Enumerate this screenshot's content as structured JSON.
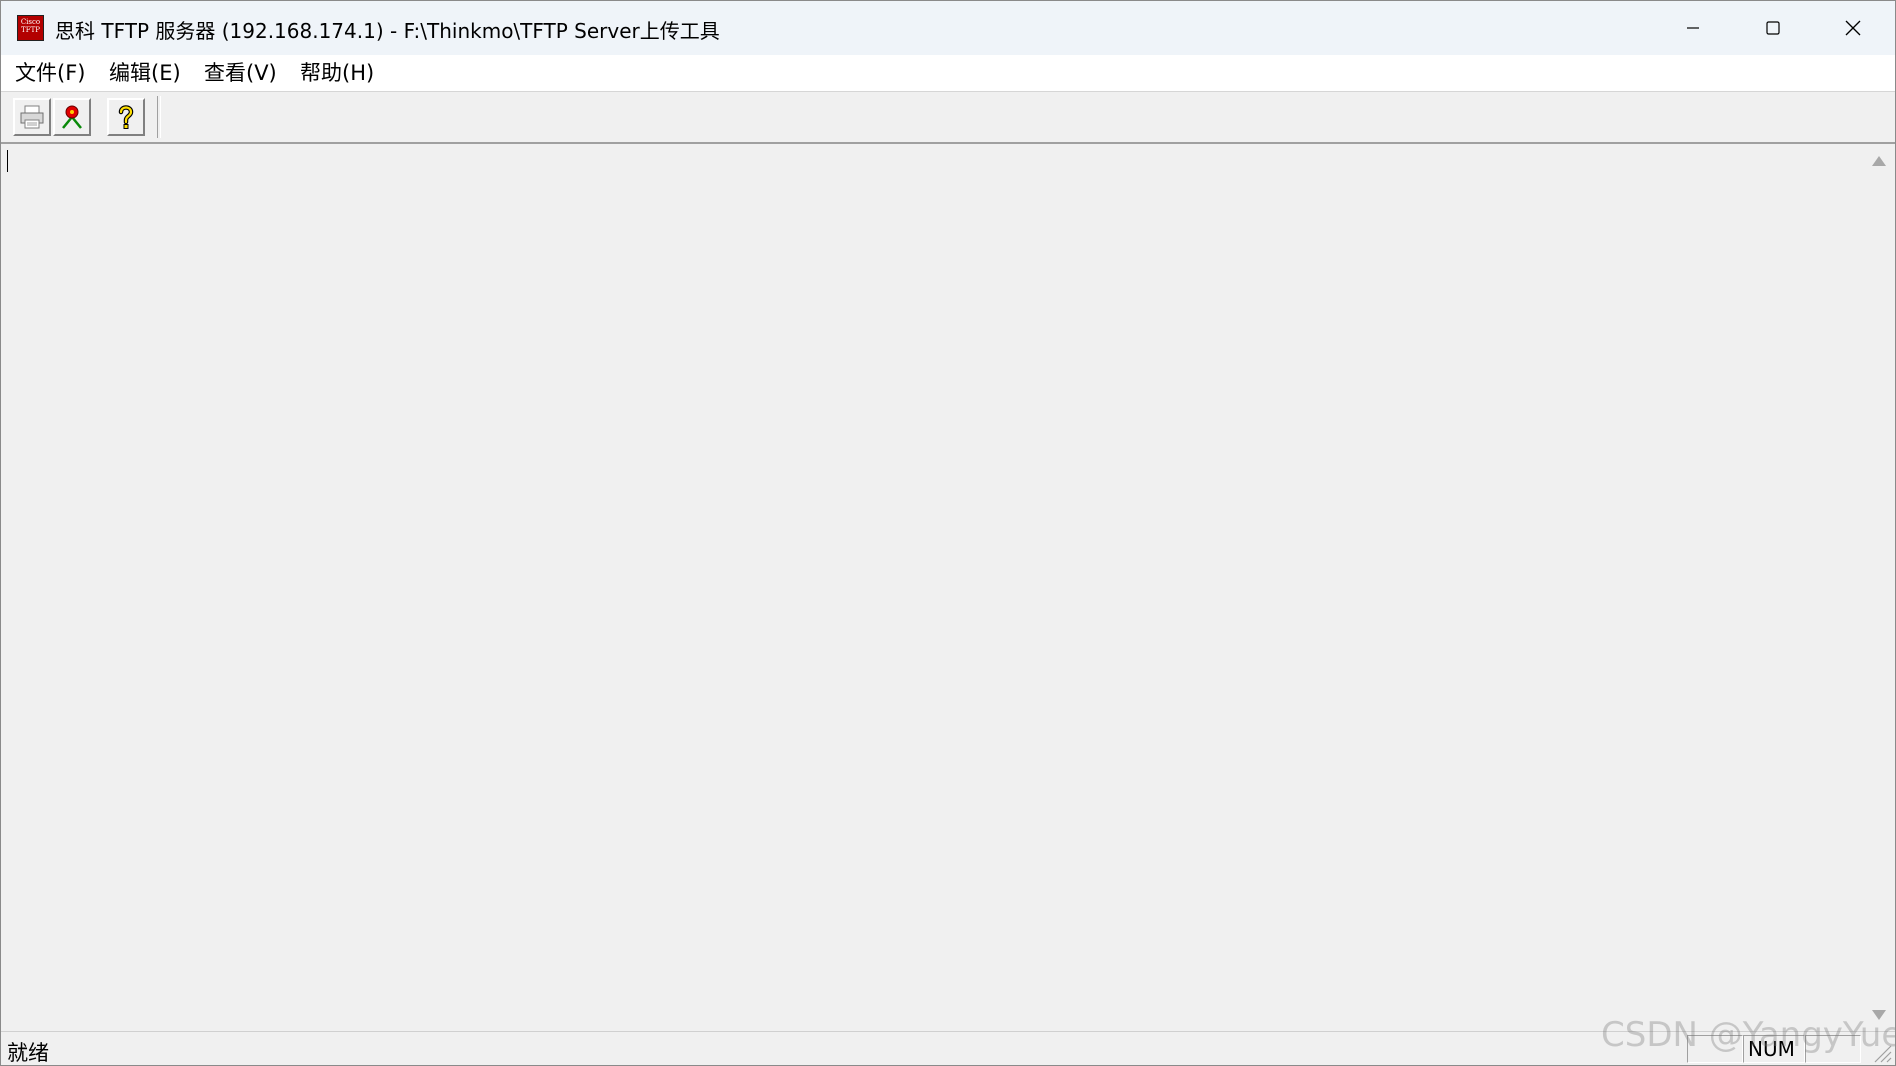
{
  "window": {
    "title": "思科 TFTP 服务器 (192.168.174.1) - F:\\Thinkmo\\TFTP Server上传工具",
    "icon_lines": [
      "Cisco",
      "TFTP"
    ]
  },
  "window_controls": {
    "minimize_icon": "minimize-icon",
    "maximize_icon": "maximize-icon",
    "close_icon": "close-icon"
  },
  "menu": {
    "items": [
      {
        "label": "文件(F)"
      },
      {
        "label": "编辑(E)"
      },
      {
        "label": "查看(V)"
      },
      {
        "label": "帮助(H)"
      }
    ]
  },
  "toolbar": {
    "buttons": [
      {
        "icon": "print-icon"
      },
      {
        "icon": "options-icon"
      },
      {
        "icon": "help-icon"
      }
    ]
  },
  "statusbar": {
    "status": "就绪",
    "num": "NUM"
  },
  "watermark": "CSDN @YangyYue",
  "colors": {
    "titlebar_bg": "#eff4f9",
    "client_bg": "#f0f0f0",
    "icon_red": "#b30000"
  }
}
